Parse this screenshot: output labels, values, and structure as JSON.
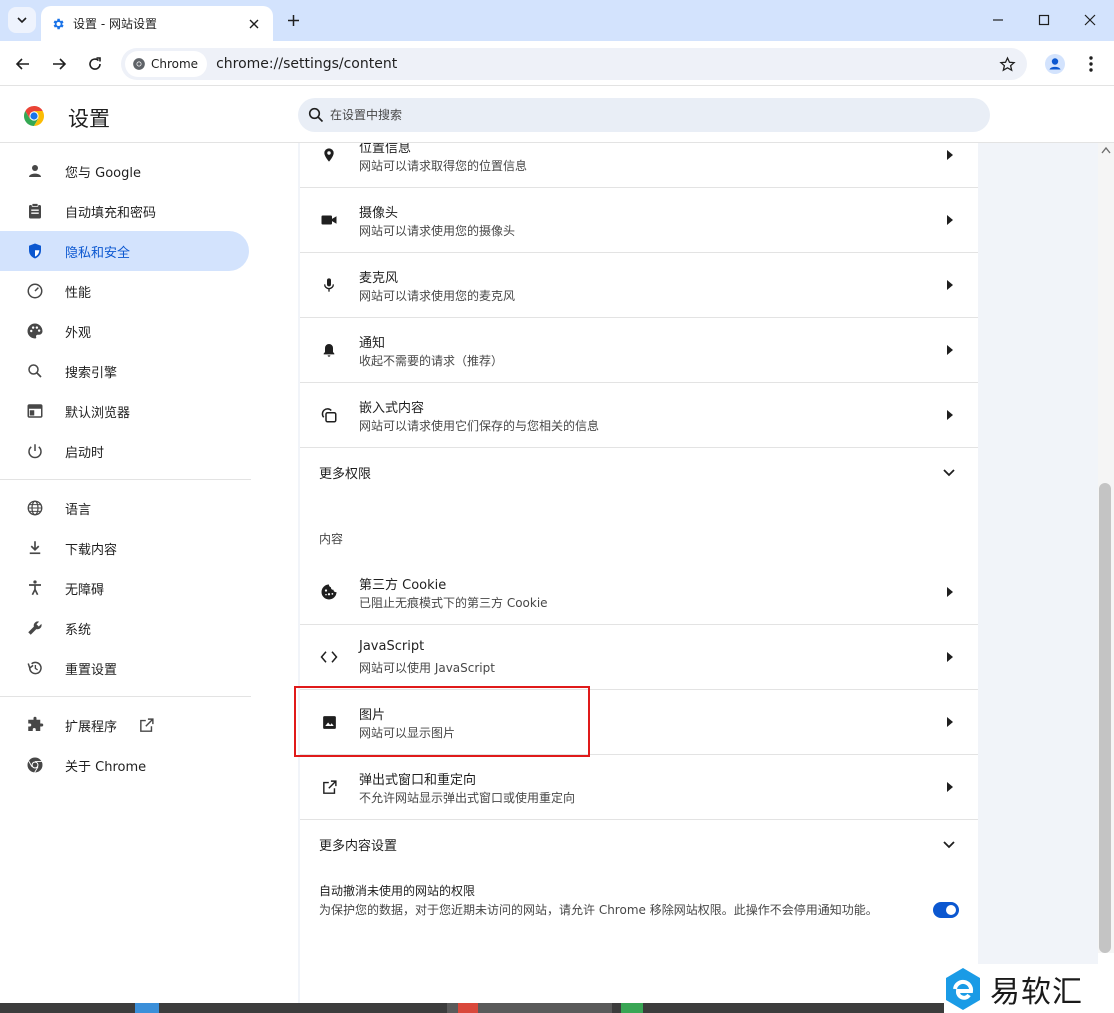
{
  "tab": {
    "title": "设置 - 网站设置"
  },
  "toolbar": {
    "chip_label": "Chrome",
    "url": "chrome://settings/content"
  },
  "header": {
    "title": "设置",
    "search_placeholder": "在设置中搜索"
  },
  "sidebar": {
    "items": [
      {
        "label": "您与 Google",
        "icon": "person-icon"
      },
      {
        "label": "自动填充和密码",
        "icon": "clipboard-icon"
      },
      {
        "label": "隐私和安全",
        "icon": "shield-icon",
        "active": true
      },
      {
        "label": "性能",
        "icon": "speedometer-icon"
      },
      {
        "label": "外观",
        "icon": "palette-icon"
      },
      {
        "label": "搜索引擎",
        "icon": "search-icon"
      },
      {
        "label": "默认浏览器",
        "icon": "browser-window-icon"
      },
      {
        "label": "启动时",
        "icon": "power-icon"
      },
      {
        "label": "语言",
        "icon": "globe-icon"
      },
      {
        "label": "下载内容",
        "icon": "download-icon"
      },
      {
        "label": "无障碍",
        "icon": "accessibility-icon"
      },
      {
        "label": "系统",
        "icon": "wrench-icon"
      },
      {
        "label": "重置设置",
        "icon": "restore-icon"
      },
      {
        "label": "扩展程序",
        "icon": "puzzle-icon"
      },
      {
        "label": "关于 Chrome",
        "icon": "chrome-icon"
      }
    ]
  },
  "permissions": [
    {
      "title": "位置信息",
      "desc": "网站可以请求取得您的位置信息",
      "icon": "location-pin-icon"
    },
    {
      "title": "摄像头",
      "desc": "网站可以请求使用您的摄像头",
      "icon": "camera-icon"
    },
    {
      "title": "麦克风",
      "desc": "网站可以请求使用您的麦克风",
      "icon": "microphone-icon"
    },
    {
      "title": "通知",
      "desc": "收起不需要的请求（推荐）",
      "icon": "bell-icon"
    },
    {
      "title": "嵌入式内容",
      "desc": "网站可以请求使用它们保存的与您相关的信息",
      "icon": "embedded-content-icon"
    }
  ],
  "more_permissions": "更多权限",
  "content_section": "内容",
  "content_items": [
    {
      "title": "第三方 Cookie",
      "desc": "已阻止无痕模式下的第三方 Cookie",
      "icon": "cookie-icon"
    },
    {
      "title": "JavaScript",
      "desc": "网站可以使用 JavaScript",
      "icon": "code-icon"
    },
    {
      "title": "图片",
      "desc": "网站可以显示图片",
      "icon": "image-icon"
    },
    {
      "title": "弹出式窗口和重定向",
      "desc": "不允许网站显示弹出式窗口或使用重定向",
      "icon": "open-in-new-icon"
    }
  ],
  "more_content": "更多内容设置",
  "auto_revoke": {
    "title": "自动撤消未使用的网站的权限",
    "desc": "为保护您的数据，对于您近期未访问的网站，请允许 Chrome 移除网站权限。此操作不会停用通知功能。",
    "enabled": true
  },
  "watermark": "易软汇",
  "colors": {
    "accent": "#0b57d0",
    "active_bg": "#d3e3fd",
    "highlight": "#e01a1a"
  }
}
